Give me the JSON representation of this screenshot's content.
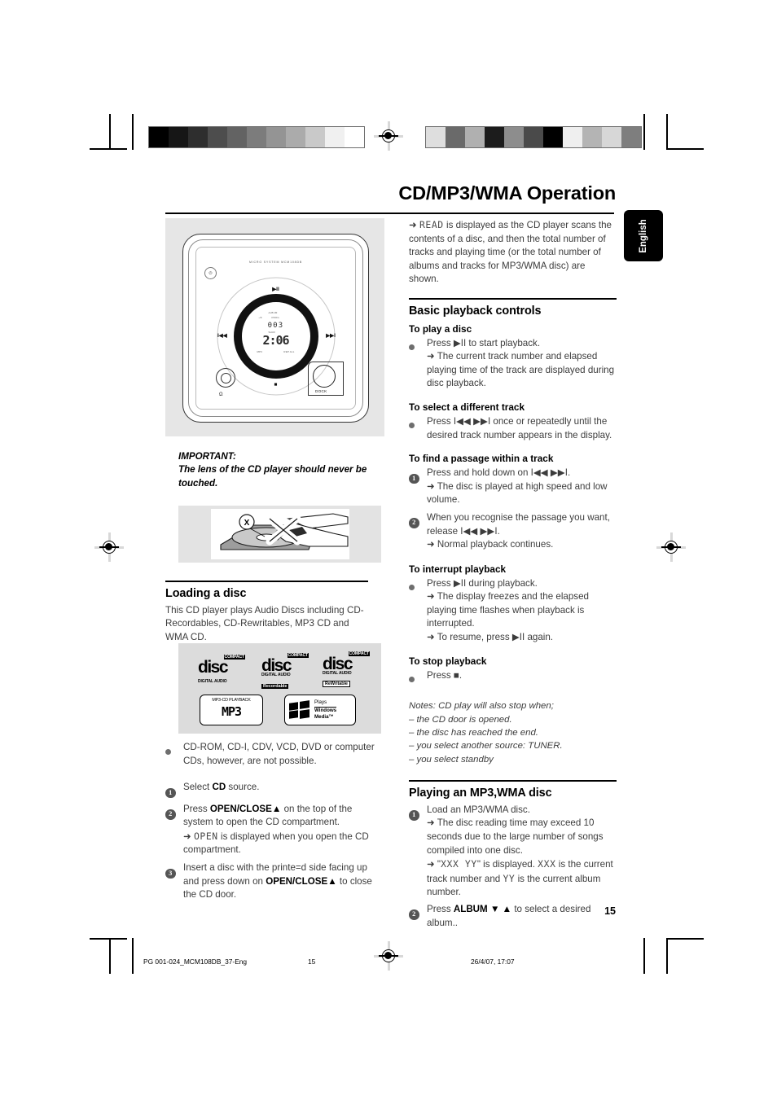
{
  "header": {
    "chapter_title": "CD/MP3/WMA Operation",
    "language_tab": "English"
  },
  "figures": {
    "unit": {
      "brand_text": "MICRO SYSTEM MCM108DB",
      "lcd_small": "003",
      "lcd_big": "2:06",
      "lcd_tags": {
        "track": "TRK",
        "prog": "PROG",
        "shuffle": "SHUF",
        "repeat": "REP ALL",
        "mp3": "MP3",
        "album": "ALBUM"
      },
      "buttons": {
        "play_pause": "▶II",
        "prev": "I◀◀",
        "next": "▶▶I",
        "stop": "■",
        "standby": "⏻",
        "dock": "DOCK",
        "headphones": "Ω"
      }
    },
    "lens_caption_x": "X"
  },
  "left_column": {
    "important_label": "IMPORTANT:",
    "important_text": "The lens of the CD player should never be touched.",
    "loading_heading": "Loading a disc",
    "loading_text": "This CD player plays Audio Discs including CD-Recordables, CD-Rewritables, MP3 CD and WMA CD.",
    "logos": [
      {
        "name": "compact-disc-digital-audio",
        "compact": "COMPACT",
        "disc": "disc",
        "digital_audio": "DIGITAL AUDIO",
        "tag": ""
      },
      {
        "name": "compact-disc-recordable",
        "compact": "COMPACT",
        "disc": "disc",
        "digital_audio": "DIGITAL AUDIO",
        "tag": "Recordable"
      },
      {
        "name": "compact-disc-rewritable",
        "compact": "COMPACT",
        "disc": "disc",
        "digital_audio": "DIGITAL AUDIO",
        "tag": "ReWritable"
      }
    ],
    "mp3_logo": {
      "title": "MP3-CD PLAYBACK",
      "text": "MP3"
    },
    "wma_logo": {
      "line1": "Plays",
      "line2": "Windows",
      "line3": "Media™",
      "tm": "™"
    },
    "not_possible": "CD-ROM, CD-I, CDV, VCD, DVD or computer CDs, however, are not possible.",
    "steps": [
      {
        "n": "1",
        "pre": "Select ",
        "bold": "CD",
        "post": " source."
      },
      {
        "n": "2",
        "line1_pre": "Press ",
        "line1_bold": "OPEN/CLOSE▲",
        "line1_post": " on the top of the system to open the CD compartment.",
        "arrow_pre": "➜ ",
        "arrow_lcd": "OPEN",
        "arrow_post": " is displayed when you open the CD compartment."
      },
      {
        "n": "3",
        "line1_pre": "Insert a disc with the printe=d side facing up and press down on ",
        "line1_bold": "OPEN/CLOSE▲",
        "line1_post": " to close the CD door."
      }
    ]
  },
  "right_column": {
    "intro_arrow": "➜ ",
    "intro_lcd": "READ",
    "intro_text": " is displayed as the CD player scans the contents of a disc, and then the total number of tracks and playing time (or the total number of albums and tracks for MP3/WMA disc) are shown.",
    "basic_heading": "Basic playback controls",
    "play_sub": "To play a disc",
    "play_line": "Press ▶II to start playback.",
    "play_arrow": "➜ The current track number and elapsed playing time of the track are displayed during disc playback.",
    "select_sub": "To select a different track",
    "select_line": "Press I◀◀  ▶▶I once or repeatedly until the desired track number appears in the display.",
    "passage_sub": "To find a passage within a track",
    "passage_steps": [
      {
        "n": "1",
        "line": "Press and hold down on I◀◀  ▶▶I.",
        "arrow": "➜ The disc is played at high speed and low volume."
      },
      {
        "n": "2",
        "line": "When you recognise the passage you want, release I◀◀  ▶▶I.",
        "arrow": "➜ Normal playback continues."
      }
    ],
    "interrupt_sub": "To interrupt playback",
    "interrupt_line": "Press ▶II during playback.",
    "interrupt_arrow1": "➜ The display freezes and the elapsed playing time flashes when playback is interrupted.",
    "interrupt_arrow2": "➜ To resume, press ▶II again.",
    "stop_sub": "To stop playback",
    "stop_line": "Press ■.",
    "notes_title": "Notes: CD play will also stop when;",
    "notes": [
      "– the CD door is opened.",
      "– the disc has reached the end.",
      "– you select another source: TUNER.",
      "– you select standby"
    ],
    "mp3_heading": "Playing an MP3,WMA disc",
    "mp3_steps": [
      {
        "n": "1",
        "line": "Load an MP3/WMA disc.",
        "arrow1": "➜ The disc reading time may exceed 10 seconds due to the large number of songs compiled into one disc.",
        "arrow2_pre": "➜ \"",
        "arrow2_lcd1": "XXX  YY",
        "arrow2_mid": "\" is displayed. ",
        "arrow2_lcd2": "XXX",
        "arrow2_mid2": " is the current track number and ",
        "arrow2_lcd3": "YY",
        "arrow2_post": " is the current album number."
      },
      {
        "n": "2",
        "pre": "Press ",
        "bold": "ALBUM ▼ ▲",
        "post": " to select a desired album.."
      }
    ]
  },
  "footer": {
    "page_number": "15",
    "file_name": "PG 001-024_MCM108DB_37-Eng",
    "page_ref": "15",
    "date_time": "26/4/07, 17:07"
  },
  "calibration": {
    "left_bar": [
      "#000000",
      "#161616",
      "#2e2e2e",
      "#4d4d4d",
      "#636363",
      "#7c7c7c",
      "#949494",
      "#ababab",
      "#c9c9c9",
      "#f0f0f0",
      "#ffffff"
    ],
    "right_bar": [
      "#dedede",
      "#6a6a6a",
      "#b0b0b0",
      "#1c1c1c",
      "#8d8d8d",
      "#4a4a4a",
      "#000000",
      "#efefef",
      "#b4b4b4",
      "#d7d7d7",
      "#7e7e7e"
    ]
  }
}
